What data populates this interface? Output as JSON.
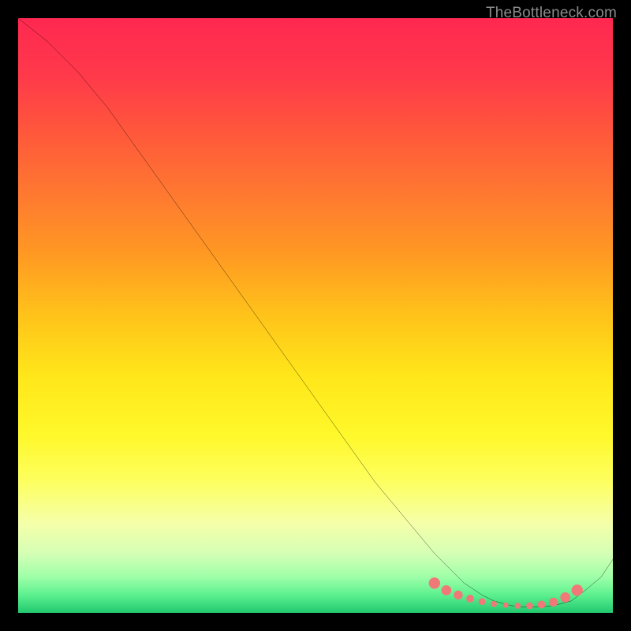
{
  "attribution": "TheBottleneck.com",
  "gradient_stops": [
    {
      "offset": 0.0,
      "color": "#ff2851"
    },
    {
      "offset": 0.1,
      "color": "#ff3a4a"
    },
    {
      "offset": 0.2,
      "color": "#ff5a3a"
    },
    {
      "offset": 0.3,
      "color": "#ff7a30"
    },
    {
      "offset": 0.4,
      "color": "#ff9a22"
    },
    {
      "offset": 0.5,
      "color": "#ffc31a"
    },
    {
      "offset": 0.6,
      "color": "#ffe61a"
    },
    {
      "offset": 0.7,
      "color": "#fff82a"
    },
    {
      "offset": 0.78,
      "color": "#fdff60"
    },
    {
      "offset": 0.85,
      "color": "#f5ffaa"
    },
    {
      "offset": 0.9,
      "color": "#d5ffb5"
    },
    {
      "offset": 0.94,
      "color": "#9effa8"
    },
    {
      "offset": 0.97,
      "color": "#5cf08f"
    },
    {
      "offset": 1.0,
      "color": "#22c96f"
    }
  ],
  "chart_data": {
    "type": "line",
    "title": "",
    "xlabel": "",
    "ylabel": "",
    "xlim": [
      0,
      100
    ],
    "ylim": [
      0,
      100
    ],
    "grid": false,
    "legend": false,
    "series": [
      {
        "name": "curve",
        "x": [
          0,
          5,
          10,
          15,
          20,
          25,
          30,
          35,
          40,
          45,
          50,
          55,
          60,
          65,
          70,
          72,
          75,
          78,
          80,
          83,
          85,
          88,
          90,
          93,
          95,
          98,
          100
        ],
        "y": [
          100,
          96,
          91,
          85,
          78,
          71,
          64,
          57,
          50,
          43,
          36,
          29,
          22,
          16,
          10,
          8,
          5,
          3,
          2,
          1.2,
          1,
          1,
          1.2,
          2,
          3.5,
          6,
          9
        ]
      }
    ],
    "markers": {
      "name": "dots",
      "x": [
        70,
        72,
        74,
        76,
        78,
        80,
        82,
        84,
        86,
        88,
        90,
        92,
        94
      ],
      "y": [
        5.0,
        3.8,
        3.0,
        2.4,
        1.9,
        1.5,
        1.3,
        1.2,
        1.2,
        1.4,
        1.8,
        2.6,
        3.8
      ],
      "min_r": 0.45,
      "max_r": 0.95
    }
  },
  "colors": {
    "curve": "#000000",
    "marker": "#f07878",
    "frame_bg": "#000000"
  }
}
